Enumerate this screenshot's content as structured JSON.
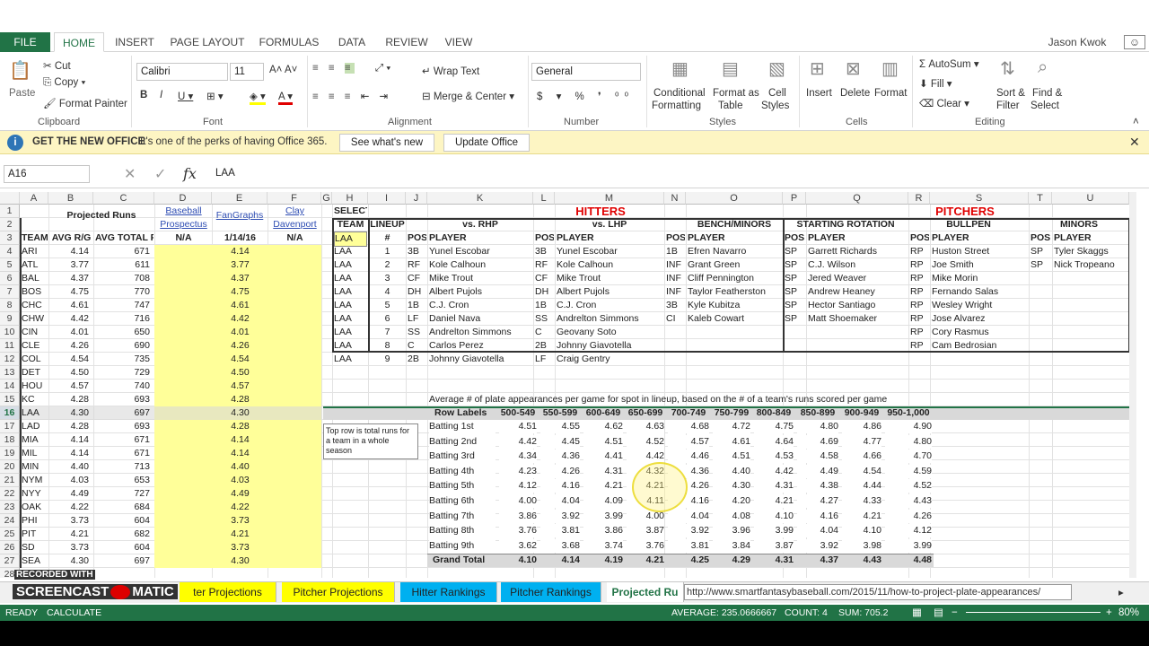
{
  "user": "Jason Kwok",
  "tabs": [
    "FILE",
    "HOME",
    "INSERT",
    "PAGE LAYOUT",
    "FORMULAS",
    "DATA",
    "REVIEW",
    "VIEW"
  ],
  "clipboard": {
    "paste": "Paste",
    "cut": "Cut",
    "copy": "Copy",
    "painter": "Format Painter",
    "label": "Clipboard"
  },
  "font": {
    "name": "Calibri",
    "size": "11",
    "label": "Font"
  },
  "alignment": {
    "wrap": "Wrap Text",
    "merge": "Merge & Center",
    "label": "Alignment"
  },
  "number": {
    "format": "General",
    "label": "Number"
  },
  "styles": {
    "cond": "Conditional",
    "cond2": "Formatting",
    "fmt": "Format as",
    "fmt2": "Table",
    "cell": "Cell",
    "cell2": "Styles",
    "label": "Styles"
  },
  "cells": {
    "insert": "Insert",
    "delete": "Delete",
    "format": "Format",
    "label": "Cells"
  },
  "editing": {
    "autosum": "AutoSum",
    "fill": "Fill",
    "clear": "Clear",
    "sort": "Sort &",
    "sort2": "Filter",
    "find": "Find &",
    "find2": "Select",
    "label": "Editing"
  },
  "message": {
    "title": "GET THE NEW OFFICE",
    "text": "It's one of the perks of having Office 365.",
    "btn1": "See what's new",
    "btn2": "Update Office"
  },
  "formula": {
    "namebox": "A16",
    "value": "LAA"
  },
  "cols": [
    "A",
    "B",
    "C",
    "D",
    "E",
    "F",
    "G",
    "H",
    "I",
    "J",
    "K",
    "L",
    "M",
    "N",
    "O",
    "P",
    "Q",
    "R",
    "S",
    "T",
    "U"
  ],
  "left": {
    "projected_runs": "Projected Runs",
    "baseball": "Baseball",
    "prospectus": "Prospectus",
    "fangraphs": "FanGraphs",
    "clay": "Clay",
    "davenport": "Davenport",
    "h_team": "TEAM",
    "h_avg": "AVG R/G",
    "h_total": "AVG TOTAL R",
    "na1": "N/A",
    "date": "1/14/16",
    "na2": "N/A",
    "rows": [
      [
        "ARI",
        "4.14",
        "671",
        "4.14"
      ],
      [
        "ATL",
        "3.77",
        "611",
        "3.77"
      ],
      [
        "BAL",
        "4.37",
        "708",
        "4.37"
      ],
      [
        "BOS",
        "4.75",
        "770",
        "4.75"
      ],
      [
        "CHC",
        "4.61",
        "747",
        "4.61"
      ],
      [
        "CHW",
        "4.42",
        "716",
        "4.42"
      ],
      [
        "CIN",
        "4.01",
        "650",
        "4.01"
      ],
      [
        "CLE",
        "4.26",
        "690",
        "4.26"
      ],
      [
        "COL",
        "4.54",
        "735",
        "4.54"
      ],
      [
        "DET",
        "4.50",
        "729",
        "4.50"
      ],
      [
        "HOU",
        "4.57",
        "740",
        "4.57"
      ],
      [
        "KC",
        "4.28",
        "693",
        "4.28"
      ],
      [
        "LAA",
        "4.30",
        "697",
        "4.30"
      ],
      [
        "LAD",
        "4.28",
        "693",
        "4.28"
      ],
      [
        "MIA",
        "4.14",
        "671",
        "4.14"
      ],
      [
        "MIL",
        "4.14",
        "671",
        "4.14"
      ],
      [
        "MIN",
        "4.40",
        "713",
        "4.40"
      ],
      [
        "NYM",
        "4.03",
        "653",
        "4.03"
      ],
      [
        "NYY",
        "4.49",
        "727",
        "4.49"
      ],
      [
        "OAK",
        "4.22",
        "684",
        "4.22"
      ],
      [
        "PHI",
        "3.73",
        "604",
        "3.73"
      ],
      [
        "PIT",
        "4.21",
        "682",
        "4.21"
      ],
      [
        "SD",
        "3.73",
        "604",
        "3.73"
      ],
      [
        "SEA",
        "4.30",
        "697",
        "4.30"
      ]
    ]
  },
  "select": {
    "l1": "SELECT",
    "l2": "TEAM",
    "val": "LAA"
  },
  "hitters": {
    "title": "HITTERS",
    "lineup": "LINEUP",
    "num": "#",
    "vsr": "vs. RHP",
    "vsl": "vs. LHP",
    "bench": "BENCH/MINORS",
    "pos": "POS",
    "player": "PLAYER",
    "rows": [
      [
        "LAA",
        "1",
        "3B",
        "Yunel Escobar",
        "3B",
        "Yunel Escobar",
        "1B",
        "Efren Navarro"
      ],
      [
        "LAA",
        "2",
        "RF",
        "Kole Calhoun",
        "RF",
        "Kole Calhoun",
        "INF",
        "Grant Green"
      ],
      [
        "LAA",
        "3",
        "CF",
        "Mike Trout",
        "CF",
        "Mike Trout",
        "INF",
        "Cliff Pennington"
      ],
      [
        "LAA",
        "4",
        "DH",
        "Albert Pujols",
        "DH",
        "Albert Pujols",
        "INF",
        "Taylor Featherston"
      ],
      [
        "LAA",
        "5",
        "1B",
        "C.J. Cron",
        "1B",
        "C.J. Cron",
        "3B",
        "Kyle Kubitza"
      ],
      [
        "LAA",
        "6",
        "LF",
        "Daniel Nava",
        "SS",
        "Andrelton Simmons",
        "CI",
        "Kaleb Cowart"
      ],
      [
        "LAA",
        "7",
        "SS",
        "Andrelton Simmons",
        "C",
        "Geovany Soto",
        "",
        ""
      ],
      [
        "LAA",
        "8",
        "C",
        "Carlos Perez",
        "2B",
        "Johnny Giavotella",
        "",
        ""
      ],
      [
        "LAA",
        "9",
        "2B",
        "Johnny Giavotella",
        "LF",
        "Craig Gentry",
        "",
        ""
      ]
    ]
  },
  "pitchers": {
    "title": "PITCHERS",
    "rot": "STARTING ROTATION",
    "bull": "BULLPEN",
    "minors": "MINORS",
    "rows": [
      [
        "SP",
        "Garrett Richards",
        "RP",
        "Huston Street",
        "SP",
        "Tyler Skaggs"
      ],
      [
        "SP",
        "C.J. Wilson",
        "RP",
        "Joe Smith",
        "SP",
        "Nick Tropeano"
      ],
      [
        "SP",
        "Jered Weaver",
        "RP",
        "Mike Morin",
        "",
        ""
      ],
      [
        "SP",
        "Andrew Heaney",
        "RP",
        "Fernando Salas",
        "",
        ""
      ],
      [
        "SP",
        "Hector Santiago",
        "RP",
        "Wesley Wright",
        "",
        ""
      ],
      [
        "SP",
        "Matt Shoemaker",
        "RP",
        "Jose Alvarez",
        "",
        ""
      ],
      [
        "",
        "",
        "RP",
        "Cory Rasmus",
        "",
        ""
      ],
      [
        "",
        "",
        "RP",
        "Cam Bedrosian",
        "",
        ""
      ]
    ]
  },
  "pivot": {
    "caption": "Average # of plate appearances per game for spot in lineup, based on the # of a team's runs scored per game",
    "header": [
      "Row Labels",
      "500-549",
      "550-599",
      "600-649",
      "650-699",
      "700-749",
      "750-799",
      "800-849",
      "850-899",
      "900-949",
      "950-1,000"
    ],
    "rows": [
      [
        "Batting 1st",
        "4.51",
        "4.55",
        "4.62",
        "4.63",
        "4.68",
        "4.72",
        "4.75",
        "4.80",
        "4.86",
        "4.90"
      ],
      [
        "Batting 2nd",
        "4.42",
        "4.45",
        "4.51",
        "4.52",
        "4.57",
        "4.61",
        "4.64",
        "4.69",
        "4.77",
        "4.80"
      ],
      [
        "Batting 3rd",
        "4.34",
        "4.36",
        "4.41",
        "4.42",
        "4.46",
        "4.51",
        "4.53",
        "4.58",
        "4.66",
        "4.70"
      ],
      [
        "Batting 4th",
        "4.23",
        "4.26",
        "4.31",
        "4.32",
        "4.36",
        "4.40",
        "4.42",
        "4.49",
        "4.54",
        "4.59"
      ],
      [
        "Batting 5th",
        "4.12",
        "4.16",
        "4.21",
        "4.21",
        "4.26",
        "4.30",
        "4.31",
        "4.38",
        "4.44",
        "4.52"
      ],
      [
        "Batting 6th",
        "4.00",
        "4.04",
        "4.09",
        "4.11",
        "4.16",
        "4.20",
        "4.21",
        "4.27",
        "4.33",
        "4.43"
      ],
      [
        "Batting 7th",
        "3.86",
        "3.92",
        "3.99",
        "4.00",
        "4.04",
        "4.08",
        "4.10",
        "4.16",
        "4.21",
        "4.26"
      ],
      [
        "Batting 8th",
        "3.76",
        "3.81",
        "3.86",
        "3.87",
        "3.92",
        "3.96",
        "3.99",
        "4.04",
        "4.10",
        "4.12"
      ],
      [
        "Batting 9th",
        "3.62",
        "3.68",
        "3.74",
        "3.76",
        "3.81",
        "3.84",
        "3.87",
        "3.92",
        "3.98",
        "3.99"
      ]
    ],
    "total": [
      "Grand Total",
      "4.10",
      "4.14",
      "4.19",
      "4.21",
      "4.25",
      "4.29",
      "4.31",
      "4.37",
      "4.43",
      "4.48"
    ]
  },
  "comment": "Top row is total runs for a team in a whole season",
  "sheets": [
    "ter Projections",
    "Pitcher Projections",
    "Hitter Rankings",
    "Pitcher Rankings",
    "Projected Ru"
  ],
  "url": "http://www.smartfantasybaseball.com/2015/11/how-to-project-plate-appearances/",
  "status": {
    "ready": "READY",
    "calc": "CALCULATE",
    "avg": "AVERAGE: 235.0666667",
    "count": "COUNT: 4",
    "sum": "SUM: 705.2",
    "zoom": "80%"
  },
  "watermark": {
    "l1": "RECORDED WITH",
    "l2": "SCREENCAST",
    "l3": "MATIC"
  },
  "colors": {
    "green": "#217346",
    "yellow": "#ffff99",
    "sheetYellow": "#ffff00",
    "sheetBlue": "#00b0f0",
    "red": "#e00000"
  }
}
